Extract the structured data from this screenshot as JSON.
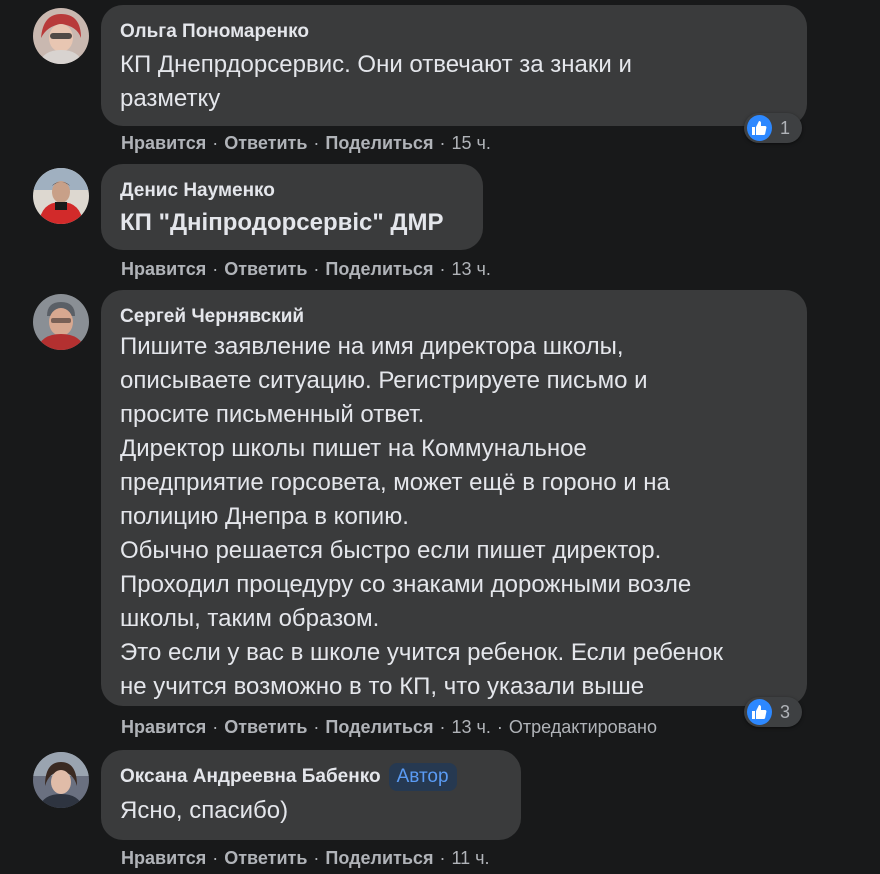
{
  "comments": [
    {
      "author": "Ольга Пономаренко",
      "text": "КП Днепрдорсервис. Они отвечают за знаки и\nразметку",
      "time": "15 ч.",
      "reactions": "1",
      "edited": ""
    },
    {
      "author": "Денис Науменко",
      "text": "КП \"Дніпродорсервіс\" ДМР",
      "time": "13 ч.",
      "reactions": "",
      "edited": ""
    },
    {
      "author": "Сергей Чернявский",
      "text": "Пишите заявление на имя директора школы,\nописываете ситуацию. Регистрируете письмо и\nпросите письменный ответ.\nДиректор школы пишет на Коммунальное\nпредприятие горсовета, может ещё в гороно и на\nполицию Днепра в копию.\nОбычно решается быстро если пишет директор.\nПроходил процедуру со знаками дорожными возле\nшколы, таким образом.\nЭто если у вас в школе учится ребенок. Если ребенок\nне учится возможно в то КП, что указали выше",
      "time": "13 ч.",
      "reactions": "3",
      "edited": "Отредактировано"
    },
    {
      "author": "Оксана Андреевна Бабенко",
      "badge": "Автор",
      "text": "Ясно, спасибо)",
      "time": "11 ч.",
      "reactions": "",
      "edited": ""
    }
  ],
  "actions": {
    "like": "Нравится",
    "reply": "Ответить",
    "share": "Поделиться",
    "separator": "·"
  },
  "icons": {
    "reaction": "like-icon"
  },
  "colors": {
    "background": "#18191a",
    "bubble": "#3a3b3c",
    "text": "#e4e6eb",
    "secondary": "#b0b3b8",
    "like_blue": "#2d88ff"
  }
}
